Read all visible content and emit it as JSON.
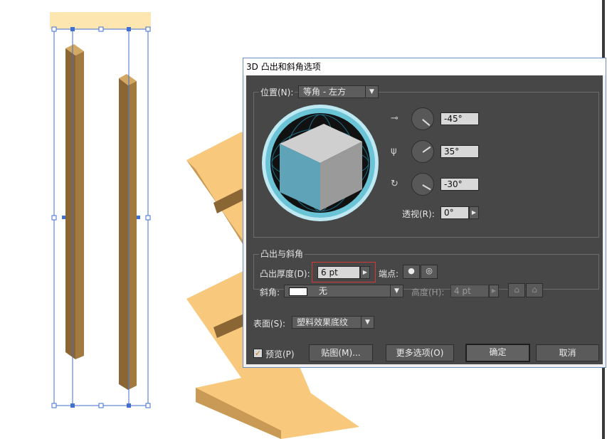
{
  "dialog": {
    "title": "3D 凸出和斜角选项",
    "position": {
      "label": "位置(N):",
      "value": "等角 - 左方",
      "rotation_x": "-45°",
      "rotation_y": "35°",
      "rotation_z": "-30°",
      "perspective_label": "透视(R):",
      "perspective_value": "0°"
    },
    "extrude": {
      "group_label": "凸出与斜角",
      "depth_label": "凸出厚度(D):",
      "depth_value": "6 pt",
      "cap_label": "端点:",
      "bevel_label": "斜角:",
      "bevel_value": "无",
      "height_label": "高度(H):",
      "height_value": "4 pt"
    },
    "surface": {
      "label": "表面(S):",
      "value": "塑料效果底纹"
    },
    "buttons": {
      "preview_label": "预览(P)",
      "preview_checked": true,
      "map": "贴图(M)...",
      "more_options": "更多选项(O)",
      "ok": "确定",
      "cancel": "取消"
    },
    "colors": {
      "cube_front": "#5ea3b8",
      "cube_top": "#cfcfcf",
      "cube_side": "#9a9a9a",
      "track_ring": "#8fd6e6"
    }
  },
  "canvas": {
    "colors": {
      "wood_light": "#f8c97c",
      "wood_dark": "#8a6634",
      "plank_face": "#a27a40",
      "selection": "#3f6fd0"
    }
  }
}
